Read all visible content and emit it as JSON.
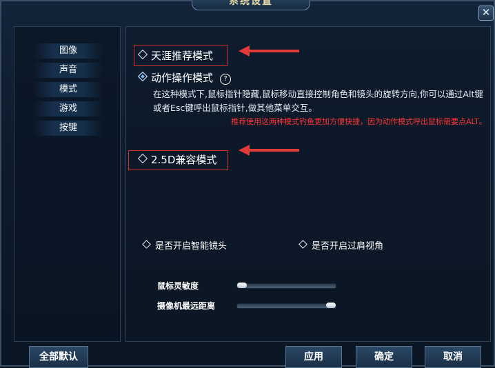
{
  "window": {
    "title": "系统设置",
    "close_glyph": "✕"
  },
  "sidebar": {
    "items": [
      {
        "label": "图像"
      },
      {
        "label": "声音"
      },
      {
        "label": "模式"
      },
      {
        "label": "游戏"
      },
      {
        "label": "按键"
      }
    ]
  },
  "modes": {
    "recommended": {
      "label": "天涯推荐模式",
      "selected": false
    },
    "action": {
      "label": "动作操作模式",
      "selected": true,
      "help_glyph": "?"
    },
    "action_desc": "在这种模式下,鼠标指针隐藏,鼠标移动直接控制角色和镜头的旋转方向,你可以通过Alt键或者Esc键呼出鼠标指针,做其他菜单交互。",
    "tip": "推荐使用这两种模式钓鱼更加方便快捷，因为动作模式呼出鼠标需要点ALT。",
    "compat": {
      "label": "2.5D兼容模式",
      "selected": false
    }
  },
  "options": {
    "smart_camera": {
      "label": "是否开启智能镜头",
      "checked": false
    },
    "over_shoulder": {
      "label": "是否开启过肩视角",
      "checked": false
    }
  },
  "sliders": {
    "mouse_sensitivity": {
      "label": "鼠标灵敏度",
      "value": 0.05
    },
    "camera_distance": {
      "label": "摄像机最远距离",
      "value": 0.95
    }
  },
  "buttons": {
    "reset_all": "全部默认",
    "apply": "应用",
    "ok": "确定",
    "cancel": "取消"
  },
  "colors": {
    "annotation_red": "#e23a36",
    "tip_red": "#ff3434",
    "selected_radio": "#7cc2ff"
  }
}
